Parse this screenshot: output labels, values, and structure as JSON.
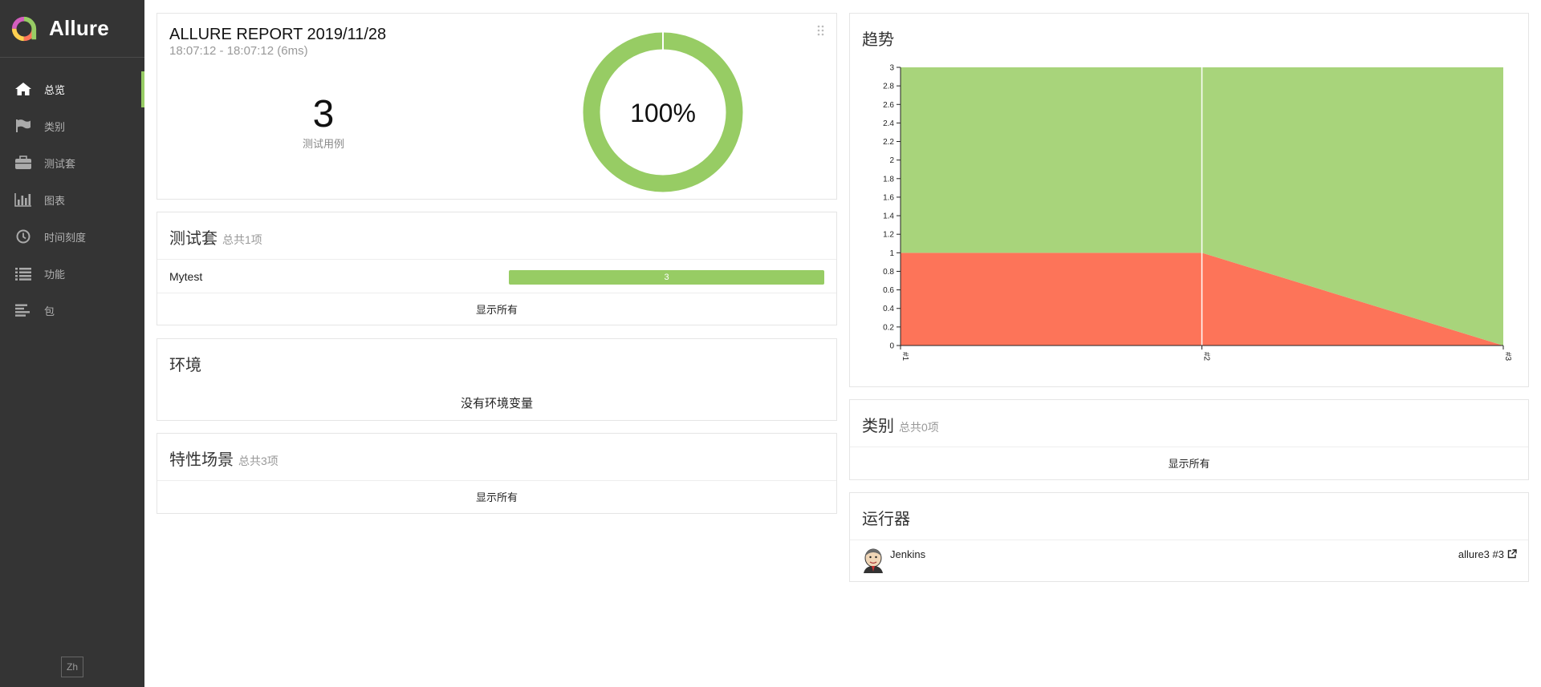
{
  "app": {
    "name": "Allure"
  },
  "sidebar": {
    "items": [
      {
        "label": "总览",
        "icon": "home-icon",
        "active": true
      },
      {
        "label": "类别",
        "icon": "flag-icon",
        "active": false
      },
      {
        "label": "测试套",
        "icon": "briefcase-icon",
        "active": false
      },
      {
        "label": "图表",
        "icon": "bar-chart-icon",
        "active": false
      },
      {
        "label": "时间刻度",
        "icon": "clock-icon",
        "active": false
      },
      {
        "label": "功能",
        "icon": "list-icon",
        "active": false
      },
      {
        "label": "包",
        "icon": "align-left-icon",
        "active": false
      }
    ],
    "lang": "Zh"
  },
  "summary": {
    "title": "ALLURE REPORT 2019/11/28",
    "time": "18:07:12 - 18:07:12 (6ms)",
    "count": "3",
    "count_label": "测试用例",
    "percent": "100%",
    "passed_fraction": 1.0
  },
  "suites": {
    "title": "测试套",
    "subtitle": "总共1项",
    "rows": [
      {
        "name": "Mytest",
        "passed": "3",
        "passed_fraction": 1.0
      }
    ],
    "show_all": "显示所有"
  },
  "environment": {
    "title": "环境",
    "message": "没有环境变量"
  },
  "features": {
    "title": "特性场景",
    "subtitle": "总共3项",
    "show_all": "显示所有"
  },
  "trend": {
    "title": "趋势"
  },
  "categories": {
    "title": "类别",
    "subtitle": "总共0项",
    "show_all": "显示所有"
  },
  "executors": {
    "title": "运行器",
    "name": "Jenkins",
    "build": "allure3 #3"
  },
  "colors": {
    "passed": "#97cc64",
    "failed": "#fd7459",
    "trend_passed": "#a8d47b",
    "sidebar": "#343434"
  },
  "chart_data": {
    "type": "area",
    "title": "",
    "x": [
      "#1",
      "#2",
      "#3"
    ],
    "series": [
      {
        "name": "",
        "color": "#fd7459",
        "values": [
          1,
          1,
          0
        ]
      },
      {
        "name": "",
        "color": "#a8d47b",
        "values": [
          2,
          2,
          3
        ]
      }
    ],
    "stacked": true,
    "ylim": [
      0,
      3
    ],
    "yticks": [
      "0",
      "0.2",
      "0.4",
      "0.6",
      "0.8",
      "1",
      "1.2",
      "1.4",
      "1.6",
      "1.8",
      "2",
      "2.2",
      "2.4",
      "2.6",
      "2.8",
      "3"
    ],
    "xlabel": "",
    "ylabel": "",
    "grid": false
  }
}
